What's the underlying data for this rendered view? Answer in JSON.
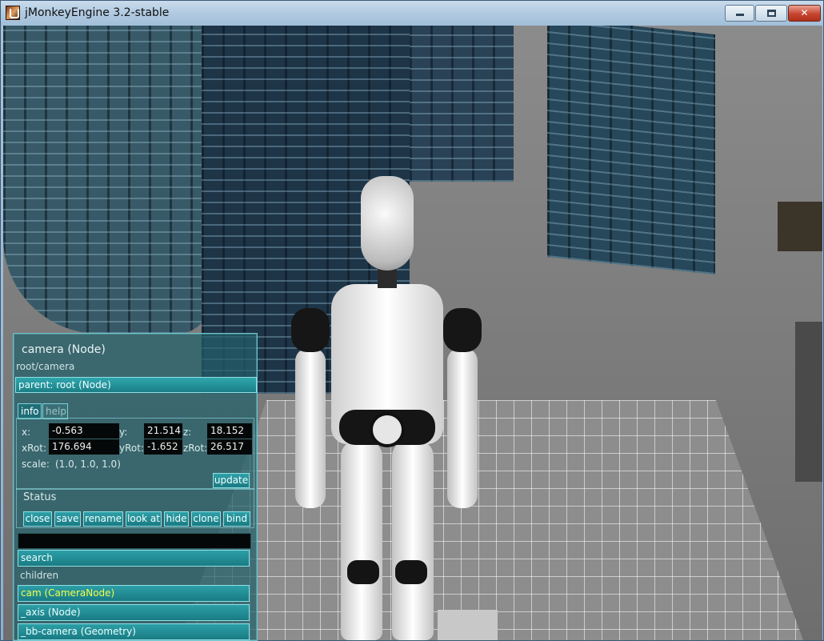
{
  "window": {
    "title": "jMonkeyEngine 3.2-stable",
    "controls": {
      "minimize": "",
      "maximize": "",
      "close": "✕"
    }
  },
  "inspector": {
    "title": "camera (Node)",
    "path": "root/camera",
    "parent": "parent: root (Node)",
    "tabs": [
      "info",
      "help"
    ],
    "labels": {
      "x": "x:",
      "y": "y:",
      "z": "z:",
      "xRot": "xRot:",
      "yRot": "yRot:",
      "zRot": "zRot:",
      "scale": "scale:"
    },
    "values": {
      "x": "-0.563",
      "y": "21.514",
      "z": "18.152",
      "xRot": "176.694",
      "yRot": "-1.652",
      "zRot": "26.517",
      "scale": "(1.0, 1.0, 1.0)"
    },
    "update_label": "update",
    "status_label": "Status",
    "actions": [
      "close",
      "save",
      "rename",
      "look at",
      "hide",
      "clone",
      "bind"
    ],
    "command_value": "",
    "search_label": "search",
    "children_label": "children",
    "children": [
      "cam (CameraNode)",
      "_axis (Node)",
      "_bb-camera (Geometry)"
    ]
  },
  "colors": {
    "panel": "#235f69",
    "highlight_text": "#f2ff4a",
    "titlebar": "#b3cbe2"
  }
}
